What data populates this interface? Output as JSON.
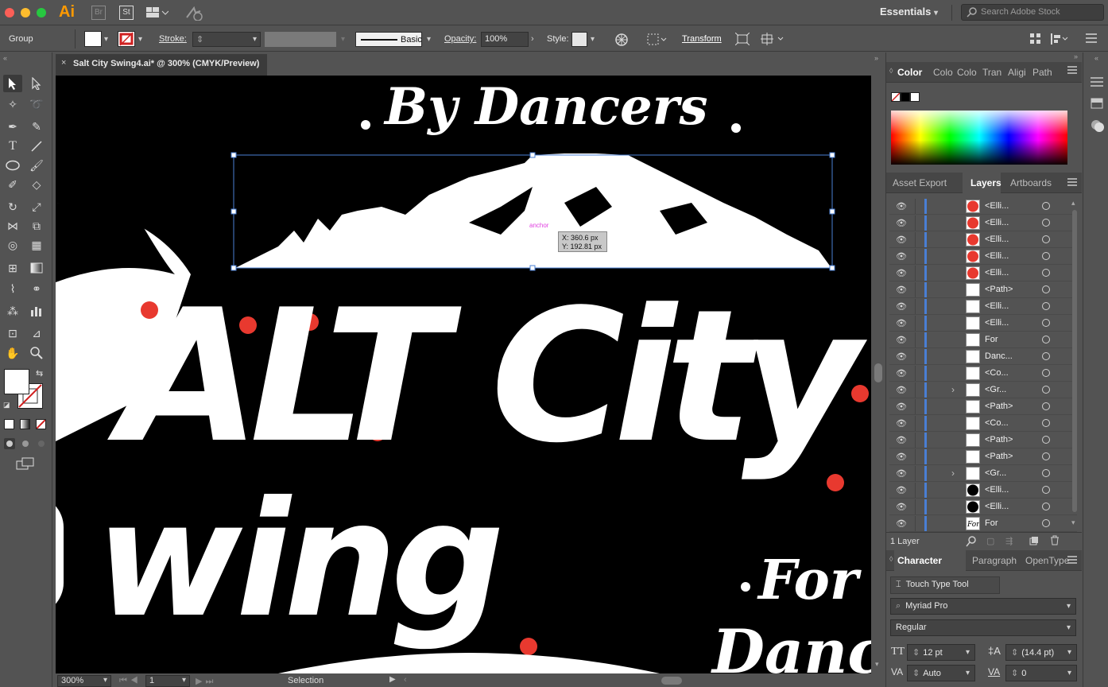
{
  "app": {
    "logo": "Ai",
    "bridge_label": "Br",
    "stock_label": "St",
    "workspace": "Essentials",
    "search_placeholder": "Search Adobe Stock"
  },
  "control_bar": {
    "selection_type": "Group",
    "stroke_label": "Stroke:",
    "brush_label": "Basic",
    "opacity_label": "Opacity:",
    "opacity_value": "100%",
    "style_label": "Style:",
    "transform_label": "Transform"
  },
  "document_tab": {
    "title": "Salt City Swing4.ai* @ 300% (CMYK/Preview)"
  },
  "canvas": {
    "tooltip_x": "X: 360.6 px",
    "tooltip_y": "Y: 192.81 px",
    "anchor_hint": "anchor",
    "text_by_dancers": "By Dancers",
    "text_alt_city": "ALT City",
    "text_wing": "wing",
    "text_for": "For",
    "text_dancer": "Dancer"
  },
  "status_bar": {
    "zoom": "300%",
    "artboard": "1",
    "tool": "Selection"
  },
  "color_panel": {
    "tabs": [
      "Color",
      "Colo",
      "Colo",
      "Tran",
      "Aligi",
      "Path"
    ]
  },
  "layers_panel": {
    "tabs": [
      "Asset Export",
      "Layers",
      "Artboards"
    ],
    "rows": [
      {
        "name": "<Elli...",
        "thumb": "red",
        "expand": ""
      },
      {
        "name": "<Elli...",
        "thumb": "red",
        "expand": ""
      },
      {
        "name": "<Elli...",
        "thumb": "red",
        "expand": ""
      },
      {
        "name": "<Elli...",
        "thumb": "red",
        "expand": ""
      },
      {
        "name": "<Elli...",
        "thumb": "red",
        "expand": ""
      },
      {
        "name": "<Path>",
        "thumb": "white",
        "expand": ""
      },
      {
        "name": "<Elli...",
        "thumb": "white",
        "expand": ""
      },
      {
        "name": "<Elli...",
        "thumb": "white",
        "expand": ""
      },
      {
        "name": "For",
        "thumb": "white",
        "expand": ""
      },
      {
        "name": "Danc...",
        "thumb": "white",
        "expand": ""
      },
      {
        "name": "<Co...",
        "thumb": "white",
        "expand": ""
      },
      {
        "name": "<Gr...",
        "thumb": "white",
        "expand": "›"
      },
      {
        "name": "<Path>",
        "thumb": "white",
        "expand": ""
      },
      {
        "name": "<Co...",
        "thumb": "white",
        "expand": ""
      },
      {
        "name": "<Path>",
        "thumb": "white",
        "expand": ""
      },
      {
        "name": "<Path>",
        "thumb": "white",
        "expand": ""
      },
      {
        "name": "<Gr...",
        "thumb": "white",
        "expand": "›"
      },
      {
        "name": "<Elli...",
        "thumb": "black",
        "expand": ""
      },
      {
        "name": "<Elli...",
        "thumb": "black",
        "expand": ""
      },
      {
        "name": "For",
        "thumb": "for",
        "expand": ""
      }
    ],
    "footer": "1 Layer"
  },
  "character_panel": {
    "tabs": [
      "Character",
      "Paragraph",
      "OpenType"
    ],
    "touch_type": "Touch Type Tool",
    "font_family": "Myriad Pro",
    "font_style": "Regular",
    "font_size": "12 pt",
    "leading": "(14.4 pt)",
    "kerning": "Auto",
    "tracking": "0"
  },
  "colors": {
    "accent_red": "#e8392f",
    "selection_blue": "#4a7fd4"
  }
}
